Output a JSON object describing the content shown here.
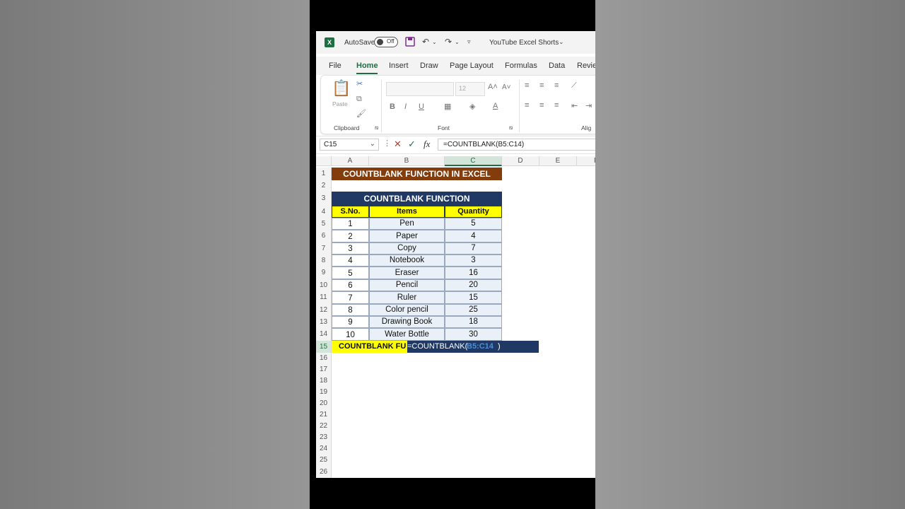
{
  "titlebar": {
    "autosave_label": "AutoSave",
    "autosave_state": "Off",
    "doc_title": "YouTube Excel Shorts",
    "logo": "X"
  },
  "menu": {
    "tabs": [
      "File",
      "Home",
      "Insert",
      "Draw",
      "Page Layout",
      "Formulas",
      "Data",
      "Revie"
    ],
    "active": "Home"
  },
  "ribbon": {
    "paste_label": "Paste",
    "font_size": "12",
    "groups": [
      "Clipboard",
      "Font",
      "Alig"
    ]
  },
  "formula_bar": {
    "name_box": "C15",
    "fx_label": "fx",
    "formula": "=COUNTBLANK(B5:C14)"
  },
  "columns": [
    "A",
    "B",
    "C",
    "D",
    "E",
    "F"
  ],
  "rows": [
    "1",
    "2",
    "3",
    "4",
    "5",
    "6",
    "7",
    "8",
    "9",
    "10",
    "11",
    "12",
    "13",
    "14",
    "15",
    "16",
    "17",
    "18",
    "19",
    "20",
    "21",
    "22",
    "23",
    "24",
    "25",
    "26"
  ],
  "sheet": {
    "main_title": "COUNTBLANK FUNCTION IN EXCEL",
    "table_title": "COUNTBLANK FUNCTION",
    "headers": [
      "S.No.",
      "Items",
      "Quantity"
    ],
    "data": [
      [
        "1",
        "Pen",
        "5"
      ],
      [
        "2",
        "Paper",
        "4"
      ],
      [
        "3",
        "Copy",
        "7"
      ],
      [
        "4",
        "Notebook",
        "3"
      ],
      [
        "5",
        "Eraser",
        "16"
      ],
      [
        "6",
        "Pencil",
        "20"
      ],
      [
        "7",
        "Ruler",
        "15"
      ],
      [
        "8",
        "Color pencil",
        "25"
      ],
      [
        "9",
        "Drawing Book",
        "18"
      ],
      [
        "10",
        "Water Bottle",
        "30"
      ]
    ],
    "row15_label": "COUNTBLANK FU",
    "row15_formula_prefix": "=COUNTBLANK(",
    "row15_formula_ref": "B5:C14",
    "row15_formula_suffix": ")"
  },
  "colors": {
    "title_bg": "#833c0b",
    "navy": "#1f3864",
    "yellow": "#ffff00",
    "excel_green": "#1f6e43"
  }
}
